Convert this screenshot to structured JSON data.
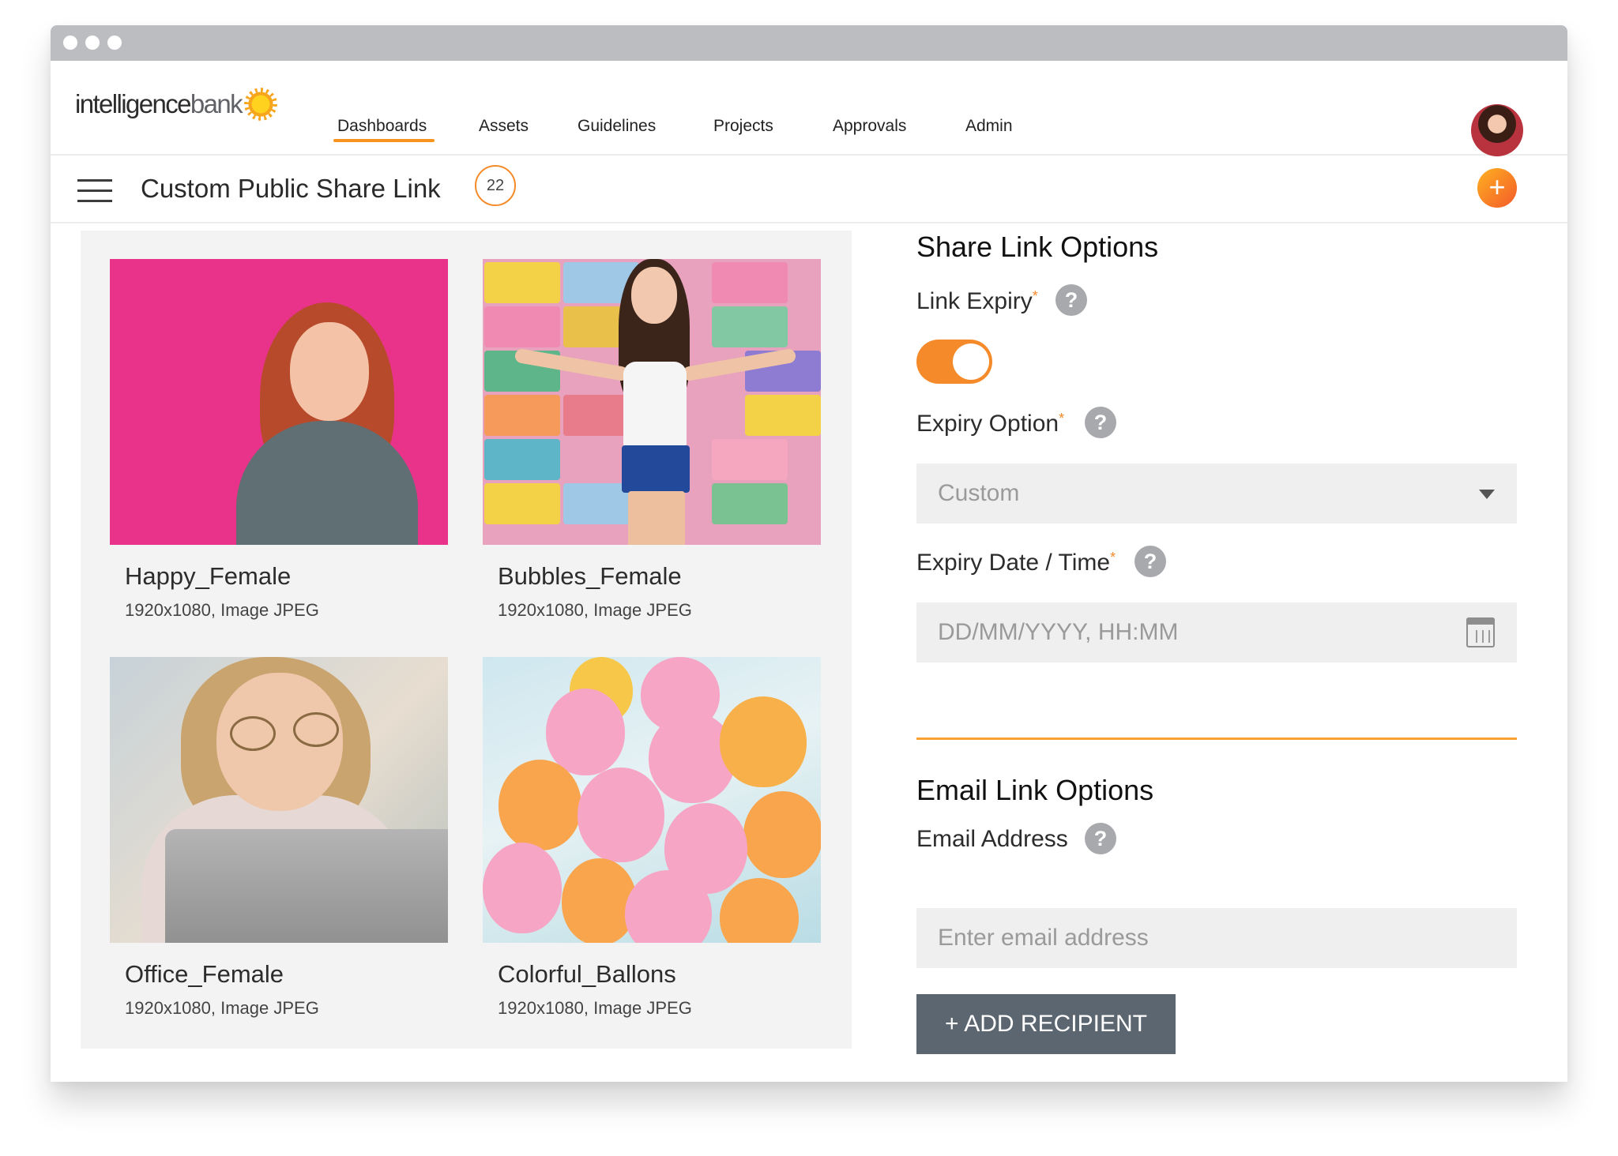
{
  "brand": {
    "logo_main": "intelligence",
    "logo_accent": "bank",
    "accent_color": "#f58a2a"
  },
  "nav": {
    "items": [
      {
        "label": "Dashboards",
        "active": true
      },
      {
        "label": "Assets"
      },
      {
        "label": "Guidelines"
      },
      {
        "label": "Projects"
      },
      {
        "label": "Approvals"
      },
      {
        "label": "Admin"
      }
    ],
    "avatar_icon": "user-avatar"
  },
  "subbar": {
    "menu_icon": "hamburger-icon",
    "title": "Custom Public Share Link",
    "count": "22",
    "add_icon": "plus-icon",
    "add_label": "+"
  },
  "assets": [
    {
      "name": "Happy_Female",
      "meta": "1920x1080, Image JPEG"
    },
    {
      "name": "Bubbles_Female",
      "meta": "1920x1080, Image JPEG"
    },
    {
      "name": "Office_Female",
      "meta": "1920x1080, Image JPEG"
    },
    {
      "name": "Colorful_Ballons",
      "meta": "1920x1080, Image JPEG"
    }
  ],
  "share_options": {
    "title": "Share Link Options",
    "link_expiry_label": "Link Expiry",
    "link_expiry_on": true,
    "expiry_option_label": "Expiry Option",
    "expiry_option_value": "Custom",
    "expiry_date_label": "Expiry Date / Time",
    "expiry_date_placeholder": "DD/MM/YYYY, HH:MM",
    "required_mark": "*",
    "help_glyph": "?"
  },
  "email_options": {
    "title": "Email Link Options",
    "email_label": "Email Address",
    "email_placeholder": "Enter email address",
    "add_button": "+ ADD RECIPIENT"
  }
}
